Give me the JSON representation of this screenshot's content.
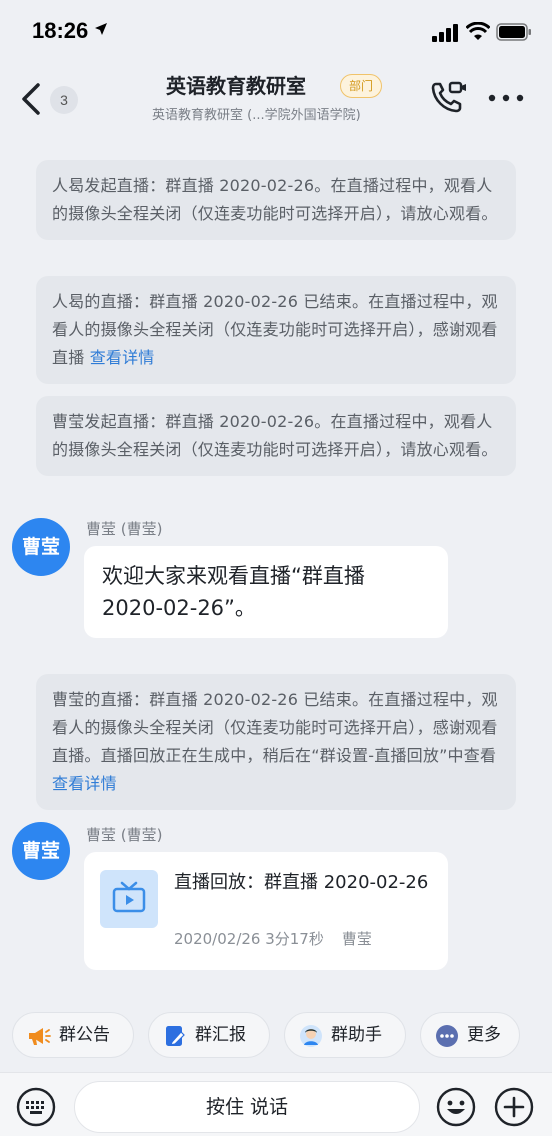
{
  "status_bar": {
    "time": "18:26"
  },
  "header": {
    "unread_count": "3",
    "title": "英语教育教研室",
    "tag": "部门",
    "subtitle": "英语教育教研室 (...学院外国语学院)"
  },
  "messages": {
    "sys1": "人曷发起直播：群直播 2020-02-26。在直播过程中，观看人的摄像头全程关闭（仅连麦功能时可选择开启），请放心观看。",
    "sys2_text": "人曷的直播：群直播 2020-02-26 已结束。在直播过程中，观看人的摄像头全程关闭（仅连麦功能时可选择开启），感谢观看直播 ",
    "sys2_link": "查看详情",
    "sys3": "曹莹发起直播：群直播 2020-02-26。在直播过程中，观看人的摄像头全程关闭（仅连麦功能时可选择开启），请放心观看。",
    "msg1_avatar": "曹莹",
    "msg1_sender": "曹莹 (曹莹)",
    "msg1_text": "欢迎大家来观看直播“群直播 2020-02-26”。",
    "sys4_text": "曹莹的直播：群直播 2020-02-26 已结束。在直播过程中，观看人的摄像头全程关闭（仅连麦功能时可选择开启），感谢观看直播。直播回放正在生成中，稍后在“群设置-直播回放”中查看 ",
    "sys4_link": "查看详情",
    "msg2_avatar": "曹莹",
    "msg2_sender": "曹莹 (曹莹)",
    "replay_title": "直播回放：群直播 2020-02-26",
    "replay_date": "2020/02/26 3分17秒",
    "replay_author": "曹莹"
  },
  "quick_actions": {
    "announcement": "群公告",
    "report": "群汇报",
    "assistant": "群助手",
    "more": "更多"
  },
  "input": {
    "hold_to_talk": "按住 说话"
  },
  "colors": {
    "accent": "#2d86f0",
    "link": "#2f7cd6",
    "tag": "#d49a1f"
  },
  "icons": [
    "location-arrow-icon",
    "cellular-signal-icon",
    "wifi-icon",
    "battery-icon",
    "back-chevron-icon",
    "video-call-icon",
    "more-dots-icon",
    "tv-play-icon",
    "megaphone-icon",
    "report-icon",
    "assistant-avatar-icon",
    "more-dots-circle-icon",
    "keyboard-icon",
    "emoji-icon",
    "plus-icon"
  ]
}
